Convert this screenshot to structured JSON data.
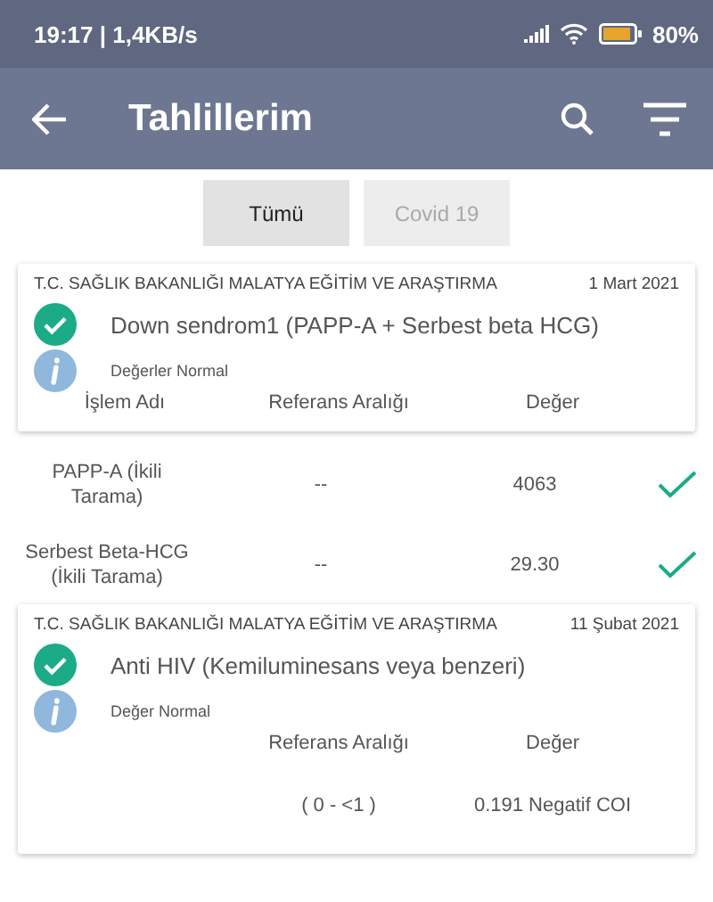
{
  "status_bar": {
    "time": "19:17 | 1,4KB/s",
    "battery": "80%"
  },
  "app_bar": {
    "title": "Tahlillerim"
  },
  "tabs": [
    {
      "label": "Tümü",
      "selected": true
    },
    {
      "label": "Covid 19",
      "selected": false
    }
  ],
  "results": [
    {
      "kind": "multi",
      "institution": "T.C. SAĞLIK BAKANLIĞI MALATYA EĞİTİM VE ARAŞTIRMA",
      "date": "1 Mart 2021",
      "title": "Down sendrom1 (PAPP-A + Serbest beta HCG)",
      "status_ok": true,
      "status_text": "Değerler Normal",
      "columns": [
        {
          "kind": "name",
          "label": "İşlem Adı"
        },
        {
          "kind": "reference",
          "label": "Referans Aralığı"
        },
        {
          "kind": "value",
          "label": "Değer"
        }
      ],
      "rows": [
        {
          "name": "PAPP-A (İkili Tarama)",
          "reference": "--",
          "value": "4063",
          "normal": true
        },
        {
          "name": "Serbest Beta-HCG (İkili Tarama)",
          "reference": "--",
          "value": "29.30",
          "normal": true
        }
      ]
    },
    {
      "kind": "single",
      "institution": "T.C. SAĞLIK BAKANLIĞI MALATYA EĞİTİM VE ARAŞTIRMA",
      "date": "11 Şubat 2021",
      "title": "Anti HIV (Kemiluminesans veya benzeri)",
      "status_ok": true,
      "status_text": "Değer Normal",
      "columns": [
        {
          "kind": "reference",
          "label": "Referans Aralığı"
        },
        {
          "kind": "value",
          "label": "Değer"
        }
      ],
      "rows": [
        {
          "reference": "( 0 - <1 )",
          "value": "0.191 Negatif COI",
          "normal": false
        }
      ]
    }
  ]
}
